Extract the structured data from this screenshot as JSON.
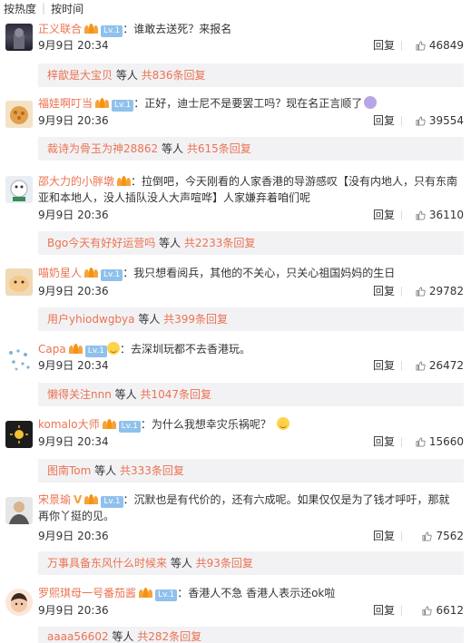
{
  "sort": {
    "hot": "按热度",
    "time": "按时间"
  },
  "reply_label": "回复",
  "more_suffix_1": " 等人 ",
  "comments": [
    {
      "user": "正义联合",
      "level": "Lv.1",
      "text": "：谁敢去送死？来报名",
      "time": "9月9日 20:34",
      "likes": "46849",
      "sub_user": "梓歆是大宝贝",
      "sub_count": "共836条回复"
    },
    {
      "user": "福娃啊叮当",
      "level": "Lv.1",
      "text": "：正好，迪士尼不是要罢工吗？现在名正言顺了",
      "time": "9月9日 20:36",
      "likes": "39554",
      "sub_user": "裁诗为骨玉为神28862",
      "sub_count": "共615条回复"
    },
    {
      "user": "邵大力的小胖墩",
      "text_a": "：拉倒吧，今天刚看的人家香港的导游感叹【没有内地人，只有东南",
      "text_b": "亚和本地人，没人插队没人大声喧哗】人家嫌弃着咱们呢",
      "time": "9月9日 20:36",
      "likes": "36110",
      "sub_user": "Bgo今天有好好运营吗",
      "sub_count": "共2233条回复"
    },
    {
      "user": "喵奶星人",
      "level": "Lv.1",
      "text": "：我只想看阅兵，其他的不关心，只关心祖国妈妈的生日",
      "time": "9月9日 20:36",
      "likes": "29782",
      "sub_user": "用户yhiodwgbya",
      "sub_count": "共399条回复"
    },
    {
      "user": "Capa",
      "level": "Lv.1",
      "text": "：去深圳玩都不去香港玩。",
      "time": "9月9日 20:34",
      "likes": "26472",
      "sub_user": "懒得关注nnn",
      "sub_count": "共1047条回复"
    },
    {
      "user": "komalo大师",
      "level": "Lv.1",
      "text": "：为什么我想幸灾乐祸呢？",
      "time": "9月9日 20:34",
      "likes": "15660",
      "sub_user": "图南Tom",
      "sub_count": "共333条回复"
    },
    {
      "user": "宋景瑜",
      "level": "Lv.1",
      "text_a": "：沉默也是有代价的，还有六成呢。如果仅仅是为了钱才呼吁，那就",
      "text_b": "再你丫挺的见。",
      "time": "9月9日 20:36",
      "likes": "7562",
      "sub_user": "万事具备东风什么时候来",
      "sub_count": "共93条回复"
    },
    {
      "user": "罗熙琪母一号番茄酱",
      "level": "Lv.1",
      "text": "：香港人不急 香港人表示还ok啦",
      "time": "9月9日 20:36",
      "likes": "6612",
      "sub_user": "aaaa56602",
      "sub_count": "共282条回复"
    }
  ]
}
